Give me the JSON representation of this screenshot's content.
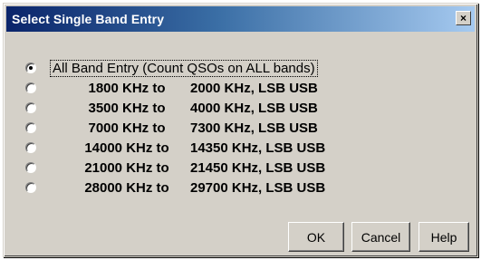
{
  "window": {
    "title": "Select Single Band Entry",
    "close_label": "×"
  },
  "options": [
    {
      "label": "All Band Entry (Count QSOs on ALL bands)",
      "checked": true
    },
    {
      "from": "1800 KHz to",
      "to": "2000 KHz, LSB USB",
      "checked": false
    },
    {
      "from": "3500 KHz to",
      "to": "4000 KHz, LSB USB",
      "checked": false
    },
    {
      "from": "7000 KHz to",
      "to": "7300 KHz, LSB USB",
      "checked": false
    },
    {
      "from": "14000 KHz to",
      "to": "14350 KHz, LSB USB",
      "checked": false
    },
    {
      "from": "21000 KHz to",
      "to": "21450 KHz, LSB USB",
      "checked": false
    },
    {
      "from": "28000 KHz to",
      "to": "29700 KHz, LSB USB",
      "checked": false
    }
  ],
  "buttons": {
    "ok": "OK",
    "cancel": "Cancel",
    "help": "Help"
  },
  "colors": {
    "title_gradient_start": "#0a246a",
    "title_gradient_end": "#a6caf0",
    "face": "#d4d0c8"
  }
}
